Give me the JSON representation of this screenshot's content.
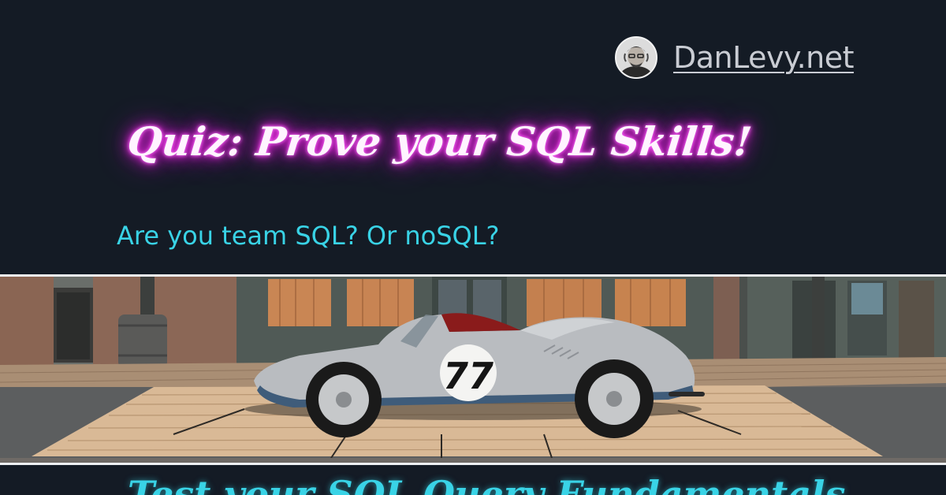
{
  "site": {
    "name": "DanLevy.net"
  },
  "post": {
    "title": "Quiz: Prove your SQL Skills!",
    "subtitle": "Are you team SQL? Or noSQL?",
    "car_number": "77",
    "next_heading": "Test your SQL Query Fundamentals"
  },
  "colors": {
    "background": "#141b25",
    "title_glow": "#ff2ff0",
    "accent": "#39d3e6",
    "site_name": "#c9ccd3"
  },
  "icons": {
    "avatar": "author-avatar-photo"
  }
}
